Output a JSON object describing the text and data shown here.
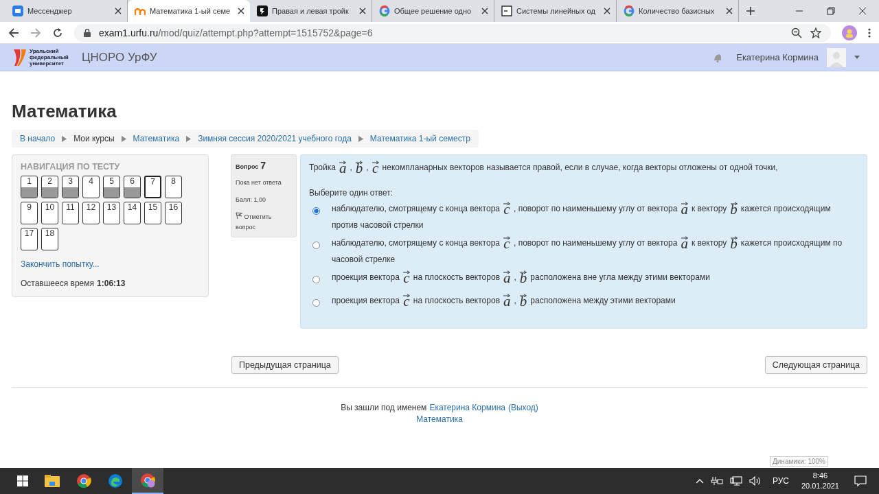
{
  "browser": {
    "tabs": [
      {
        "kind": "messenger",
        "title": "Мессенджер",
        "selected": false
      },
      {
        "kind": "moodle",
        "title": "Математика 1-ый семе",
        "selected": true
      },
      {
        "kind": "dark",
        "title": "Правая и левая тройк",
        "selected": false
      },
      {
        "kind": "google",
        "title": "Общее решение одно",
        "selected": false
      },
      {
        "kind": "doc",
        "title": "Системы линейных од",
        "selected": false
      },
      {
        "kind": "google",
        "title": "Количество базисных",
        "selected": false
      }
    ],
    "address": {
      "host": "exam1.urfu.ru",
      "path": "/mod/quiz/attempt.php?attempt=1515752&page=6"
    }
  },
  "site_header": {
    "logo_text": "Уральский федеральный университет",
    "site_name": "ЦНОРО УрФУ",
    "user_name": "Екатерина Кормина"
  },
  "page_title": "Математика",
  "breadcrumbs": [
    {
      "label": "В начало",
      "link": true
    },
    {
      "label": "Мои курсы",
      "link": false
    },
    {
      "label": "Математика",
      "link": true
    },
    {
      "label": "Зимняя сессия 2020/2021 учебного года",
      "link": true
    },
    {
      "label": "Математика 1-ый семестр",
      "link": true
    }
  ],
  "quiz_nav": {
    "title": "НАВИГАЦИЯ ПО ТЕСТУ",
    "buttons": [
      {
        "label": "1",
        "answered": true,
        "selected": false
      },
      {
        "label": "2",
        "answered": true,
        "selected": false
      },
      {
        "label": "3",
        "answered": true,
        "selected": false
      },
      {
        "label": "4",
        "answered": false,
        "selected": false
      },
      {
        "label": "5",
        "answered": true,
        "selected": false
      },
      {
        "label": "6",
        "answered": true,
        "selected": false
      },
      {
        "label": "7",
        "answered": false,
        "selected": true
      },
      {
        "label": "8",
        "answered": false,
        "selected": false
      },
      {
        "label": "9",
        "answered": false,
        "selected": false
      },
      {
        "label": "10",
        "answered": false,
        "selected": false
      },
      {
        "label": "11",
        "answered": false,
        "selected": false
      },
      {
        "label": "12",
        "answered": false,
        "selected": false
      },
      {
        "label": "13",
        "answered": false,
        "selected": false
      },
      {
        "label": "14",
        "answered": false,
        "selected": false
      },
      {
        "label": "15",
        "answered": false,
        "selected": false
      },
      {
        "label": "16",
        "answered": false,
        "selected": false
      },
      {
        "label": "17",
        "answered": false,
        "selected": false
      },
      {
        "label": "18",
        "answered": false,
        "selected": false
      }
    ],
    "finish_link": "Закончить попытку...",
    "time_label": "Оставшееся время",
    "time_value": "1:06:13"
  },
  "question_info": {
    "label": "Вопрос",
    "number": "7",
    "status": "Пока нет ответа",
    "grade": "Балл: 1,00",
    "flag_label": "Отметить вопрос"
  },
  "question": {
    "text": [
      {
        "kind": "text",
        "text": "Тройка"
      },
      {
        "kind": "vec",
        "text": "a"
      },
      {
        "kind": "text",
        "text": ","
      },
      {
        "kind": "vec",
        "text": "b"
      },
      {
        "kind": "text",
        "text": ","
      },
      {
        "kind": "vec",
        "text": "c"
      },
      {
        "kind": "text",
        "text": "некомпланарных векторов называется правой, если в случае, когда векторы отложены от одной точки,"
      }
    ],
    "prompt": "Выберите один ответ:",
    "options": [
      {
        "selected": true,
        "parts": [
          {
            "kind": "text",
            "text": "наблюдателю, смотрящему с конца вектора"
          },
          {
            "kind": "vec",
            "text": "c"
          },
          {
            "kind": "text",
            "text": ", поворот по наименьшему углу от вектора"
          },
          {
            "kind": "vec",
            "text": "a"
          },
          {
            "kind": "text",
            "text": "к вектору"
          },
          {
            "kind": "vec",
            "text": "b"
          },
          {
            "kind": "text",
            "text": "кажется происходящим"
          },
          {
            "kind": "text",
            "text": "против часовой стрелки"
          }
        ]
      },
      {
        "selected": false,
        "parts": [
          {
            "kind": "text",
            "text": "наблюдателю, смотрящему с конца вектора"
          },
          {
            "kind": "vec",
            "text": "c"
          },
          {
            "kind": "text",
            "text": ", поворот по наименьшему углу от вектора"
          },
          {
            "kind": "vec",
            "text": "a"
          },
          {
            "kind": "text",
            "text": "к вектору"
          },
          {
            "kind": "vec",
            "text": "b"
          },
          {
            "kind": "text",
            "text": "кажется происходящим по"
          },
          {
            "kind": "text",
            "text": "часовой стрелке"
          }
        ]
      },
      {
        "selected": false,
        "parts": [
          {
            "kind": "text",
            "text": "проекция вектора"
          },
          {
            "kind": "vec",
            "text": "c"
          },
          {
            "kind": "text",
            "text": "на плоскость векторов"
          },
          {
            "kind": "vec",
            "text": "a"
          },
          {
            "kind": "text",
            "text": ","
          },
          {
            "kind": "vec",
            "text": "b"
          },
          {
            "kind": "text",
            "text": "расположена вне угла между этими векторами"
          }
        ]
      },
      {
        "selected": false,
        "parts": [
          {
            "kind": "text",
            "text": "проекция вектора"
          },
          {
            "kind": "vec",
            "text": "c"
          },
          {
            "kind": "text",
            "text": "на плоскость векторов"
          },
          {
            "kind": "vec",
            "text": "a"
          },
          {
            "kind": "text",
            "text": ","
          },
          {
            "kind": "vec",
            "text": "b"
          },
          {
            "kind": "text",
            "text": "расположена между этими векторами"
          }
        ]
      }
    ]
  },
  "page_buttons": {
    "previous": "Предыдущая страница",
    "next": "Следующая страница"
  },
  "footer": {
    "logged_in_text": "Вы зашли под именем",
    "user_link": "Екатерина Кормина",
    "logout_link": "(Выход)",
    "course_link": "Математика"
  },
  "tooltip": "Динамики: 100%",
  "taskbar": {
    "language": "РУС",
    "time": "8:46",
    "date": "20.01.2021"
  }
}
